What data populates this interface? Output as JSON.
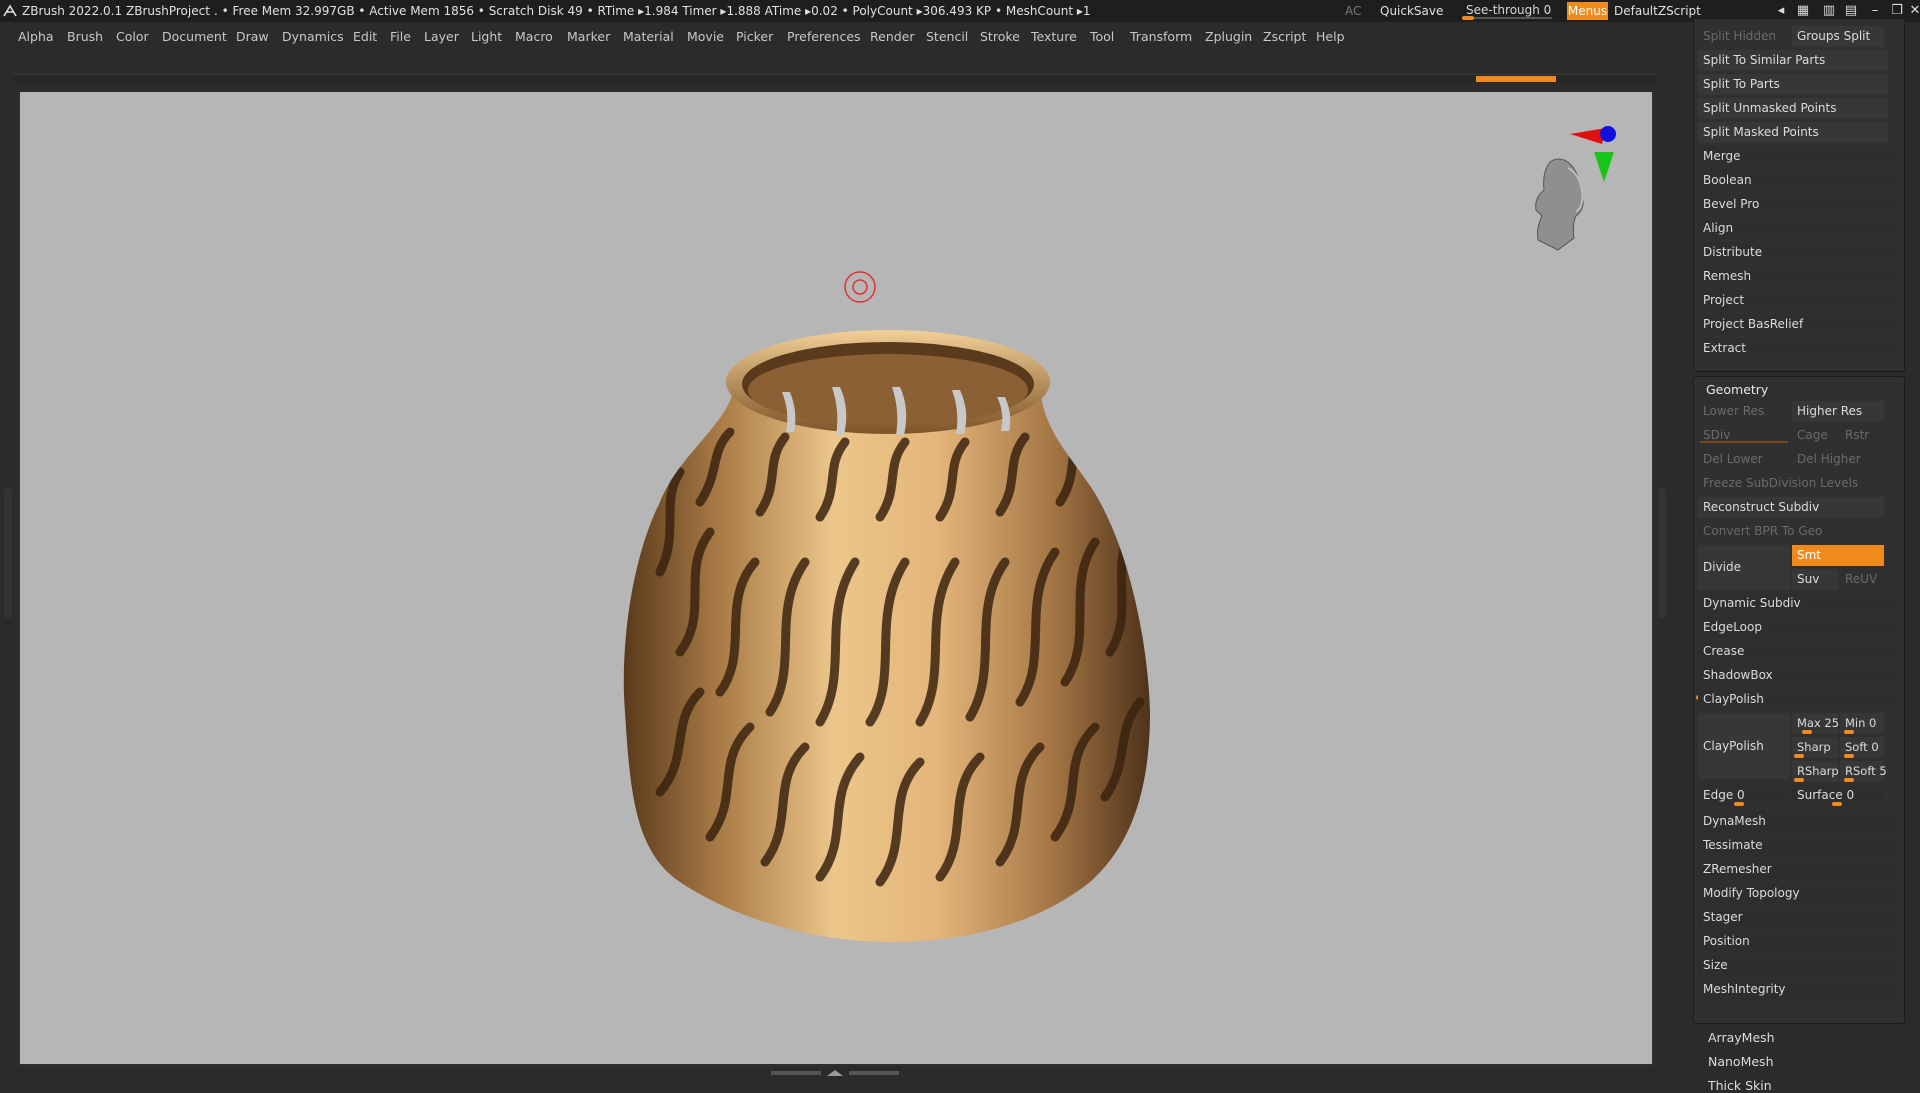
{
  "titlebar": {
    "app": "ZBrush 2022.0.1",
    "project": "ZBrushProject",
    "stats": ". • Free Mem 32.997GB • Active Mem 1856 • Scratch Disk 49 •  RTime ▸1.984 Timer ▸1.888 ATime ▸0.02 • PolyCount ▸306.493 KP  • MeshCount ▸1",
    "ac": "AC",
    "quicksave": "QuickSave",
    "see_through": "See-through  0",
    "see_through_value": 0,
    "menus": "Menus",
    "script": "DefaultZScript"
  },
  "menu": [
    "Alpha",
    "Brush",
    "Color",
    "Document",
    "Draw",
    "Dynamics",
    "Edit",
    "File",
    "Layer",
    "Light",
    "Macro",
    "Marker",
    "Material",
    "Movie",
    "Picker",
    "Preferences",
    "Render",
    "Stencil",
    "Stroke",
    "Texture",
    "Tool",
    "Transform",
    "Zplugin",
    "Zscript",
    "Help"
  ],
  "subtool": {
    "split_hidden": "Split Hidden",
    "groups_split": "Groups Split",
    "items": [
      "Split To Similar Parts",
      "Split To Parts",
      "Split Unmasked Points",
      "Split Masked Points"
    ],
    "items2": [
      "Merge",
      "Boolean",
      "Bevel Pro",
      "Align",
      "Distribute",
      "Remesh",
      "Project",
      "Project BasRelief",
      "Extract"
    ]
  },
  "geometry": {
    "title": "Geometry",
    "lower_res": "Lower Res",
    "higher_res": "Higher Res",
    "sdiv": "SDiv",
    "cage": "Cage",
    "rstr": "Rstr",
    "del_lower": "Del Lower",
    "del_higher": "Del Higher",
    "freeze": "Freeze SubDivision Levels",
    "reconstruct": "Reconstruct Subdiv",
    "convert": "Convert BPR To Geo",
    "divide": "Divide",
    "smt": "Smt",
    "suv": "Suv",
    "reuv": "ReUV",
    "items": [
      "Dynamic Subdiv",
      "EdgeLoop",
      "Crease",
      "ShadowBox"
    ],
    "claypolish_header": "ClayPolish",
    "claypolish_btn": "ClayPolish",
    "max": "Max 25",
    "min": "Min 0",
    "sharp": "Sharp",
    "soft": "Soft 0",
    "rsharp": "RSharp",
    "rsoft": "RSoft 5",
    "edge": "Edge 0",
    "surface": "Surface 0",
    "items3": [
      "DynaMesh",
      "Tessimate",
      "ZRemesher",
      "Modify Topology",
      "Stager",
      "Position",
      "Size",
      "MeshIntegrity"
    ]
  },
  "bottom_items": [
    "ArrayMesh",
    "NanoMesh",
    "Thick Skin"
  ],
  "colors": {
    "accent": "#f08a1c",
    "viewport_bg": "#b6b6b6",
    "panel": "#2b2b2b"
  }
}
